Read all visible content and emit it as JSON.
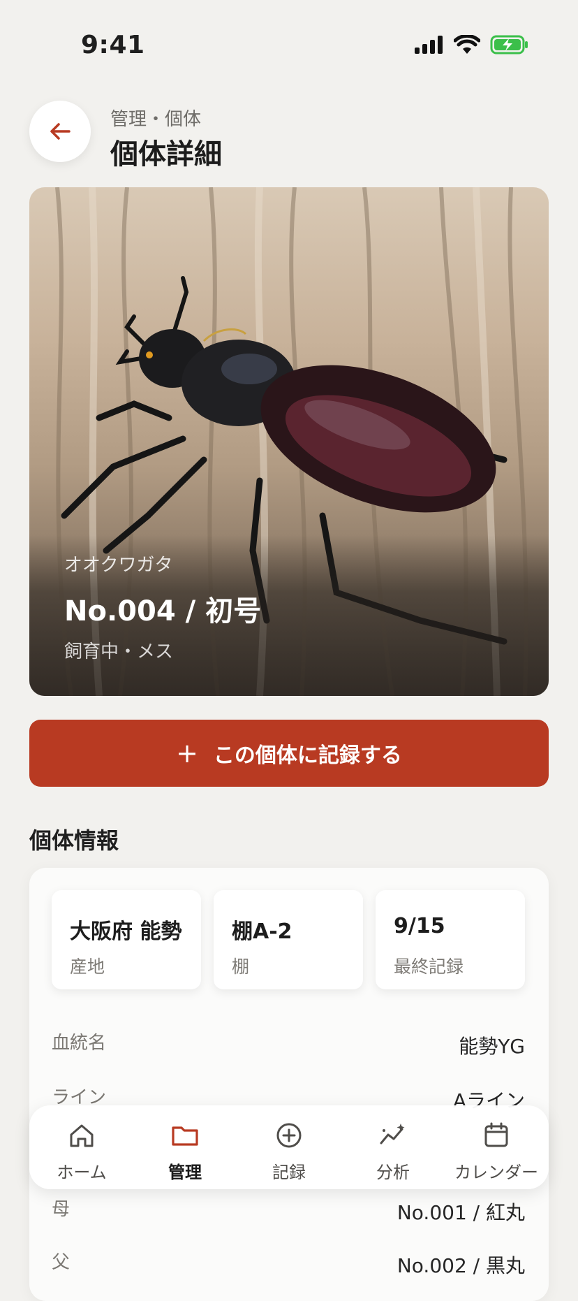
{
  "status_bar": {
    "time": "9:41"
  },
  "header": {
    "breadcrumb": "管理・個体",
    "title": "個体詳細"
  },
  "hero": {
    "species": "オオクワガタ",
    "name": "No.004 / 初号",
    "status": "飼育中・メス"
  },
  "cta": {
    "icon": "plus-icon",
    "label": "この個体に記録する"
  },
  "section": {
    "title": "個体情報"
  },
  "stats": [
    {
      "value": "大阪府 能勢",
      "label": "産地"
    },
    {
      "value": "棚A-2",
      "label": "棚"
    },
    {
      "value": "9/15",
      "label": "最終記録"
    }
  ],
  "details": [
    {
      "key": "血統名",
      "value": "能勢YG"
    },
    {
      "key": "ライン",
      "value": "Aライン"
    },
    {
      "key": "母",
      "value": "No.001 / 紅丸"
    },
    {
      "key": "父",
      "value": "No.002 / 黒丸"
    }
  ],
  "tabbar": {
    "active": "管理",
    "items": [
      {
        "label": "ホーム",
        "icon": "home-icon"
      },
      {
        "label": "管理",
        "icon": "folder-icon"
      },
      {
        "label": "記録",
        "icon": "plus-circle-icon"
      },
      {
        "label": "分析",
        "icon": "sparkline-icon"
      },
      {
        "label": "カレンダー",
        "icon": "calendar-icon"
      }
    ]
  },
  "colors": {
    "accent": "#b83a22",
    "background": "#f2f1ee",
    "card": "#ffffff"
  }
}
